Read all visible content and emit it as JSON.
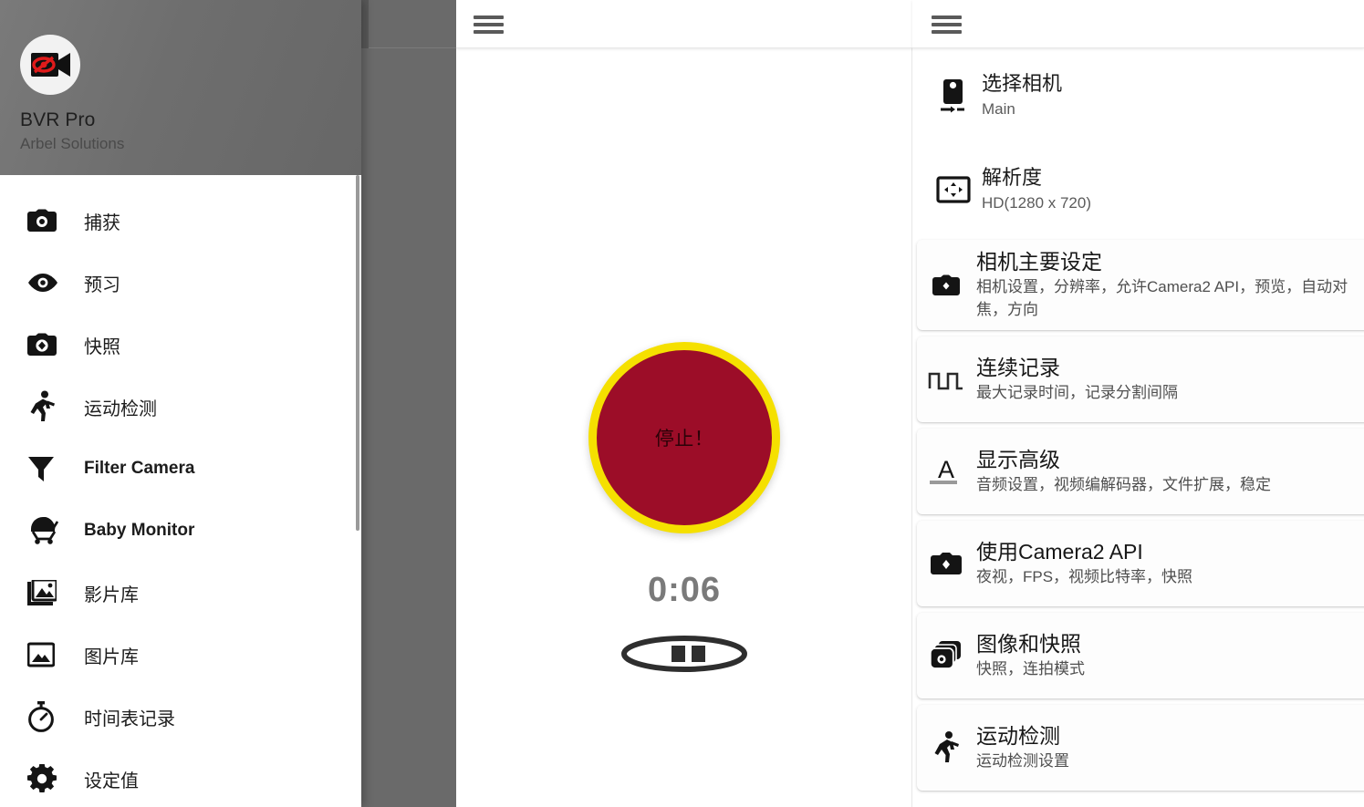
{
  "app": {
    "name": "BVR Pro",
    "developer": "Arbel Solutions",
    "logo_icon": "video-camera-hidden-eye-icon"
  },
  "topbars": {
    "center_menu_icon": "hamburger-menu-icon",
    "right_menu_icon": "hamburger-menu-icon"
  },
  "sidebar": {
    "items": [
      {
        "label": "捕获",
        "icon": "camera-icon",
        "latin": false
      },
      {
        "label": "预习",
        "icon": "eye-icon",
        "latin": false
      },
      {
        "label": "快照",
        "icon": "snapshot-camera-icon",
        "latin": false
      },
      {
        "label": "运动检测",
        "icon": "running-person-icon",
        "latin": false
      },
      {
        "label": "Filter Camera",
        "icon": "funnel-filter-icon",
        "latin": true
      },
      {
        "label": "Baby Monitor",
        "icon": "stroller-icon",
        "latin": true
      },
      {
        "label": "影片库",
        "icon": "video-library-icon",
        "latin": false
      },
      {
        "label": "图片库",
        "icon": "photo-library-icon",
        "latin": false
      },
      {
        "label": "时间表记录",
        "icon": "stopwatch-icon",
        "latin": false
      },
      {
        "label": "设定值",
        "icon": "gear-icon",
        "latin": false
      }
    ]
  },
  "recorder": {
    "stop_label": "停止！",
    "timer": "0:06",
    "pause_icon": "pause-pill-icon",
    "button_fill": "#9C0D28",
    "button_ring": "#F5E000",
    "timer_color": "#7a7a7a"
  },
  "settings": {
    "plain_rows": [
      {
        "title": "选择相机",
        "value": "Main",
        "icon": "phone-camera-select-icon"
      },
      {
        "title": "解析度",
        "value": "HD(1280 x 720)",
        "icon": "resolution-arrows-icon"
      }
    ],
    "cards": [
      {
        "title": "相机主要设定",
        "subtitle": "相机设置，分辨率，允许Camera2 API，预览，自动对焦，方向",
        "icon": "camera-settings-icon"
      },
      {
        "title": "连续记录",
        "subtitle": "最大记录时间，记录分割间隔",
        "icon": "square-wave-icon"
      },
      {
        "title": "显示高级",
        "subtitle": "音频设置，视频编解码器，文件扩展，稳定",
        "icon": "letter-a-underline-icon"
      },
      {
        "title": "使用Camera2 API",
        "subtitle": "夜视，FPS，视频比特率，快照",
        "icon": "camera-api-icon"
      },
      {
        "title": "图像和快照",
        "subtitle": "快照，连拍模式",
        "icon": "burst-photos-icon"
      },
      {
        "title": "运动检测",
        "subtitle": "运动检测设置",
        "icon": "running-person-icon"
      }
    ]
  }
}
